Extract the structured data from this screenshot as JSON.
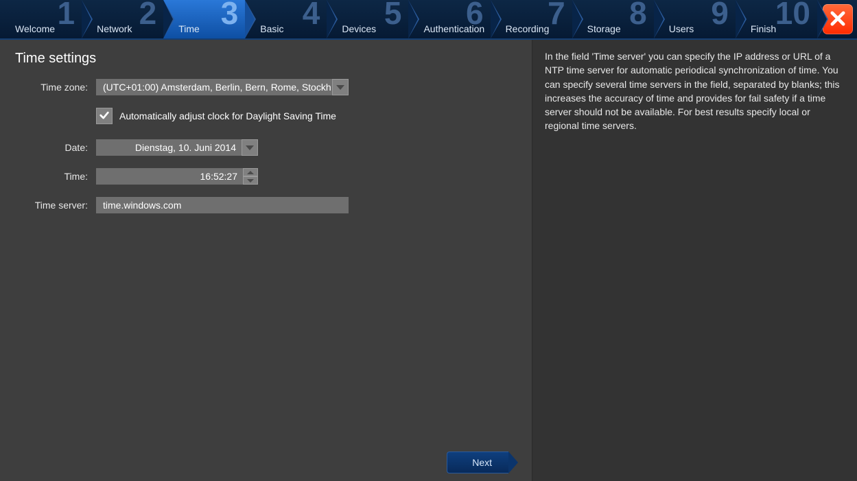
{
  "wizard": {
    "steps": [
      {
        "num": "1",
        "label": "Welcome"
      },
      {
        "num": "2",
        "label": "Network"
      },
      {
        "num": "3",
        "label": "Time"
      },
      {
        "num": "4",
        "label": "Basic"
      },
      {
        "num": "5",
        "label": "Devices"
      },
      {
        "num": "6",
        "label": "Authentication"
      },
      {
        "num": "7",
        "label": "Recording"
      },
      {
        "num": "8",
        "label": "Storage"
      },
      {
        "num": "9",
        "label": "Users"
      },
      {
        "num": "10",
        "label": "Finish"
      }
    ],
    "active_index": 2,
    "next_label": "Next"
  },
  "page": {
    "title": "Time settings",
    "labels": {
      "timezone": "Time zone:",
      "date": "Date:",
      "time": "Time:",
      "timeserver": "Time server:"
    },
    "timezone_value": "(UTC+01:00) Amsterdam, Berlin, Bern, Rome, Stockh",
    "dst_checkbox_label": "Automatically adjust clock for Daylight Saving Time",
    "dst_checked": true,
    "date_value": "Dienstag, 10. Juni 2014",
    "time_value": "16:52:27",
    "timeserver_value": "time.windows.com"
  },
  "help": {
    "text": "In the field 'Time server' you can specify the IP address or URL of a NTP time server for automatic periodical synchronization of time. You can specify several time servers in the field, separated by blanks; this increases the accuracy of time and provides for fail safety if a time server should not be available. For best results specify local or regional time servers."
  }
}
